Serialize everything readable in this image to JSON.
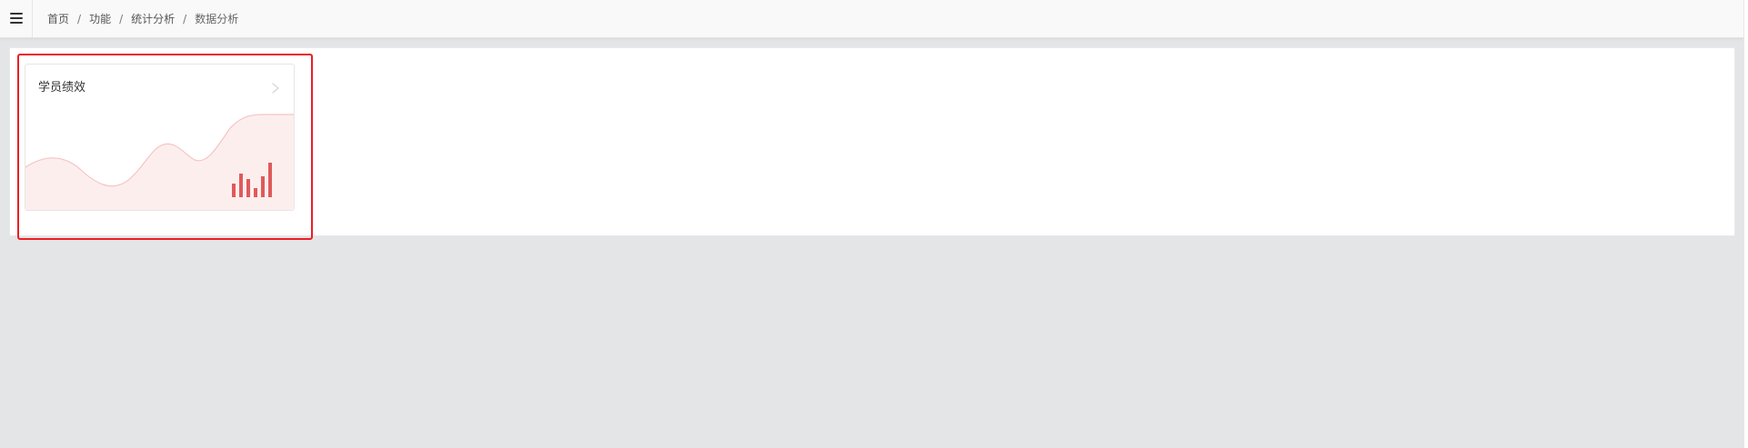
{
  "breadcrumb": {
    "items": [
      "首页",
      "功能",
      "统计分析"
    ],
    "current": "数据分析",
    "separator": "/"
  },
  "card": {
    "title": "学员绩效",
    "icon": "chevron-right-icon",
    "decoration": "wave-chart-bars"
  },
  "colors": {
    "highlight_border": "#ee1d25",
    "chart_wave_fill": "#fdeeee",
    "chart_wave_stroke": "#f6c4c4",
    "chart_bars": "#e05a5a",
    "background": "#e4e5e7"
  },
  "toolbar": {
    "menu_icon": "hamburger-menu-icon"
  }
}
